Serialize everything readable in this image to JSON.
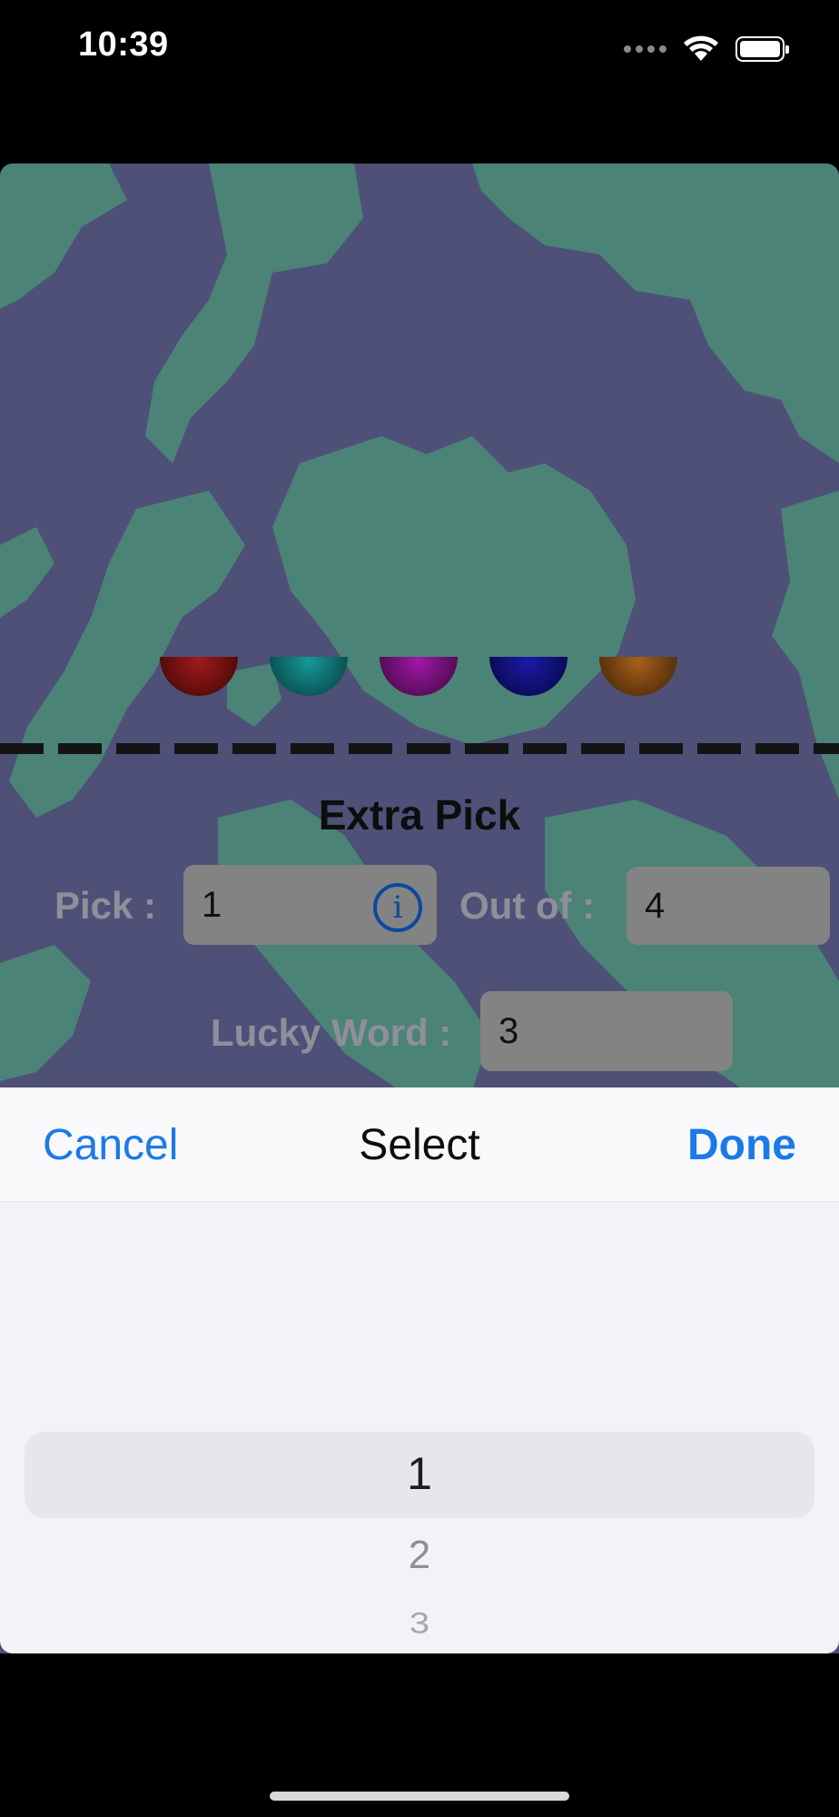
{
  "status_bar": {
    "time": "10:39",
    "signal_icon": "cellular-dots-icon",
    "wifi_icon": "wifi-icon",
    "battery_icon": "battery-full-icon"
  },
  "game": {
    "balls": [
      {
        "color": "#8a1212"
      },
      {
        "color": "#0f7c7c"
      },
      {
        "color": "#7c1080"
      },
      {
        "color": "#10108a"
      },
      {
        "color": "#8a4a10"
      }
    ],
    "section_title": "Extra Pick",
    "pick": {
      "label": "Pick :",
      "value": "1",
      "info_icon": "info-circle-icon"
    },
    "out_of": {
      "label": "Out of :",
      "value": "4"
    },
    "lucky_word": {
      "label": "Lucky Word :",
      "value": "3"
    }
  },
  "picker": {
    "cancel_label": "Cancel",
    "title": "Select",
    "done_label": "Done",
    "options": [
      "1",
      "2",
      "3"
    ],
    "selected": "1"
  },
  "colors": {
    "accent": "#1a7ae8",
    "overlay_bg": "#52547c",
    "land": "#4e8a7a"
  }
}
